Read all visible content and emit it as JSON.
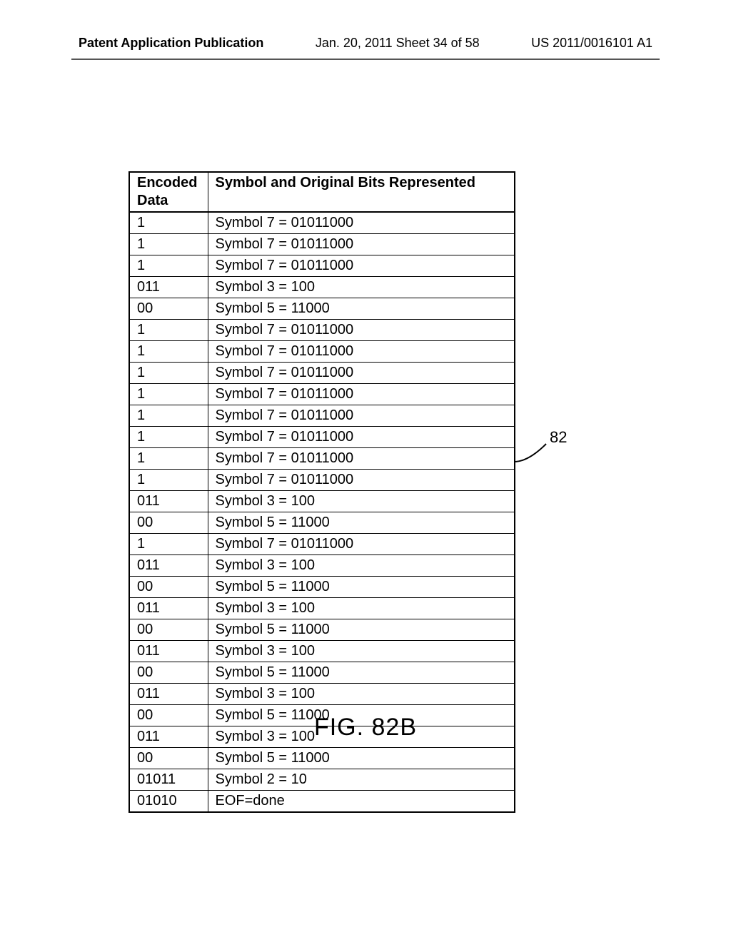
{
  "header": {
    "left": "Patent Application Publication",
    "mid": "Jan. 20, 2011   Sheet 34 of 58",
    "right": "US 2011/0016101 A1"
  },
  "table": {
    "columns": {
      "encoded": "Encoded Data",
      "symbol": "Symbol and Original Bits Represented"
    },
    "rows": [
      {
        "encoded": "1",
        "symbol": "Symbol 7 = 01011000"
      },
      {
        "encoded": "1",
        "symbol": "Symbol 7 = 01011000"
      },
      {
        "encoded": "1",
        "symbol": "Symbol 7 = 01011000"
      },
      {
        "encoded": "011",
        "symbol": "Symbol 3 = 100"
      },
      {
        "encoded": "00",
        "symbol": "Symbol 5 = 11000"
      },
      {
        "encoded": "1",
        "symbol": "Symbol 7 = 01011000"
      },
      {
        "encoded": "1",
        "symbol": "Symbol 7 = 01011000"
      },
      {
        "encoded": "1",
        "symbol": "Symbol 7 = 01011000"
      },
      {
        "encoded": "1",
        "symbol": "Symbol 7 = 01011000"
      },
      {
        "encoded": "1",
        "symbol": "Symbol 7 = 01011000"
      },
      {
        "encoded": "1",
        "symbol": "Symbol 7 = 01011000"
      },
      {
        "encoded": "1",
        "symbol": "Symbol 7 = 01011000"
      },
      {
        "encoded": "1",
        "symbol": "Symbol 7 = 01011000"
      },
      {
        "encoded": "011",
        "symbol": "Symbol 3 = 100"
      },
      {
        "encoded": "00",
        "symbol": "Symbol 5 = 11000"
      },
      {
        "encoded": "1",
        "symbol": "Symbol 7 = 01011000"
      },
      {
        "encoded": "011",
        "symbol": "Symbol 3 = 100"
      },
      {
        "encoded": "00",
        "symbol": "Symbol 5 = 11000"
      },
      {
        "encoded": "011",
        "symbol": "Symbol 3 = 100"
      },
      {
        "encoded": "00",
        "symbol": "Symbol 5 = 11000"
      },
      {
        "encoded": "011",
        "symbol": "Symbol 3 = 100"
      },
      {
        "encoded": "00",
        "symbol": "Symbol 5 = 11000"
      },
      {
        "encoded": "011",
        "symbol": "Symbol 3 = 100"
      },
      {
        "encoded": "00",
        "symbol": "Symbol 5 = 11000"
      },
      {
        "encoded": "011",
        "symbol": "Symbol 3 = 100"
      },
      {
        "encoded": "00",
        "symbol": "Symbol 5 = 11000"
      },
      {
        "encoded": "01011",
        "symbol": "Symbol 2 = 10"
      },
      {
        "encoded": "01010",
        "symbol": "EOF=done"
      }
    ]
  },
  "callout": {
    "label": "82"
  },
  "figure": {
    "label": "FIG. 82B"
  }
}
